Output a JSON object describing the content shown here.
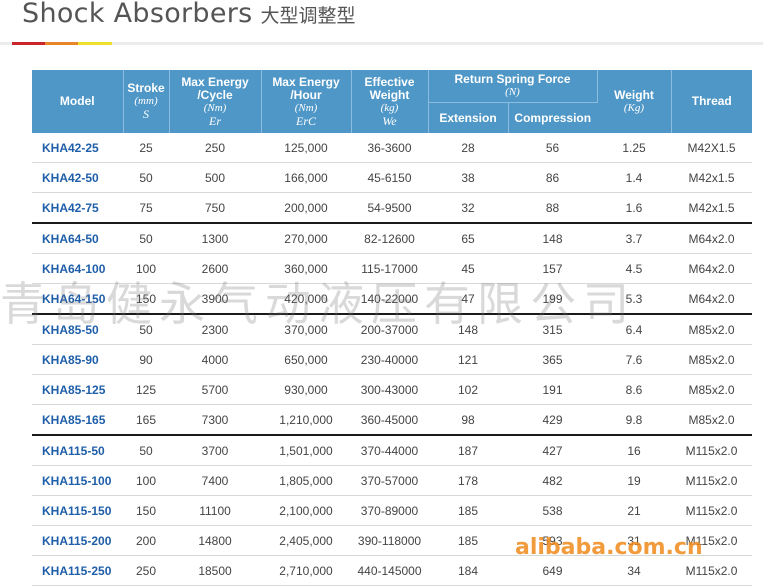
{
  "title": {
    "en": "Shock Absorbers",
    "cn": "大型调整型"
  },
  "headers": {
    "model": "Model",
    "stroke": "Stroke",
    "stroke_unit": "(mm)",
    "stroke_sym": "S",
    "max_energy_cycle": "Max Energy",
    "max_energy_cycle_2": "/Cycle",
    "max_energy_cycle_unit": "(Nm)",
    "max_energy_cycle_sym": "Er",
    "max_energy_hour": "Max Energy",
    "max_energy_hour_2": "/Hour",
    "max_energy_hour_unit": "(Nm)",
    "max_energy_hour_sym": "ErC",
    "effective_weight": "Effective",
    "effective_weight_2": "Weight",
    "effective_weight_unit": "(kg)",
    "effective_weight_sym": "We",
    "return_spring_force": "Return Spring Force",
    "return_spring_force_unit": "(N)",
    "extension": "Extension",
    "compression": "Compression",
    "weight": "Weight",
    "weight_unit": "(Kg)",
    "thread": "Thread"
  },
  "rows": [
    {
      "model": "KHA42-25",
      "stroke": "25",
      "energy_cycle": "250",
      "energy_hour": "125,000",
      "eff_weight": "36-3600",
      "extension": "28",
      "compression": "56",
      "weight": "1.25",
      "thread": "M42X1.5"
    },
    {
      "model": "KHA42-50",
      "stroke": "50",
      "energy_cycle": "500",
      "energy_hour": "166,000",
      "eff_weight": "45-6150",
      "extension": "38",
      "compression": "86",
      "weight": "1.4",
      "thread": "M42x1.5"
    },
    {
      "model": "KHA42-75",
      "stroke": "75",
      "energy_cycle": "750",
      "energy_hour": "200,000",
      "eff_weight": "54-9500",
      "extension": "32",
      "compression": "88",
      "weight": "1.6",
      "thread": "M42x1.5"
    },
    {
      "model": "KHA64-50",
      "stroke": "50",
      "energy_cycle": "1300",
      "energy_hour": "270,000",
      "eff_weight": "82-12600",
      "extension": "65",
      "compression": "148",
      "weight": "3.7",
      "thread": "M64x2.0"
    },
    {
      "model": "KHA64-100",
      "stroke": "100",
      "energy_cycle": "2600",
      "energy_hour": "360,000",
      "eff_weight": "115-17000",
      "extension": "45",
      "compression": "157",
      "weight": "4.5",
      "thread": "M64x2.0"
    },
    {
      "model": "KHA64-150",
      "stroke": "150",
      "energy_cycle": "3900",
      "energy_hour": "420,000",
      "eff_weight": "140-22000",
      "extension": "47",
      "compression": "199",
      "weight": "5.3",
      "thread": "M64x2.0"
    },
    {
      "model": "KHA85-50",
      "stroke": "50",
      "energy_cycle": "2300",
      "energy_hour": "370,000",
      "eff_weight": "200-37000",
      "extension": "148",
      "compression": "315",
      "weight": "6.4",
      "thread": "M85x2.0"
    },
    {
      "model": "KHA85-90",
      "stroke": "90",
      "energy_cycle": "4000",
      "energy_hour": "650,000",
      "eff_weight": "230-40000",
      "extension": "121",
      "compression": "365",
      "weight": "7.6",
      "thread": "M85x2.0"
    },
    {
      "model": "KHA85-125",
      "stroke": "125",
      "energy_cycle": "5700",
      "energy_hour": "930,000",
      "eff_weight": "300-43000",
      "extension": "102",
      "compression": "191",
      "weight": "8.6",
      "thread": "M85x2.0"
    },
    {
      "model": "KHA85-165",
      "stroke": "165",
      "energy_cycle": "7300",
      "energy_hour": "1,210,000",
      "eff_weight": "360-45000",
      "extension": "98",
      "compression": "429",
      "weight": "9.8",
      "thread": "M85x2.0"
    },
    {
      "model": "KHA115-50",
      "stroke": "50",
      "energy_cycle": "3700",
      "energy_hour": "1,501,000",
      "eff_weight": "370-44000",
      "extension": "187",
      "compression": "427",
      "weight": "16",
      "thread": "M115x2.0"
    },
    {
      "model": "KHA115-100",
      "stroke": "100",
      "energy_cycle": "7400",
      "energy_hour": "1,805,000",
      "eff_weight": "370-57000",
      "extension": "178",
      "compression": "482",
      "weight": "19",
      "thread": "M115x2.0"
    },
    {
      "model": "KHA115-150",
      "stroke": "150",
      "energy_cycle": "11100",
      "energy_hour": "2,100,000",
      "eff_weight": "370-89000",
      "extension": "185",
      "compression": "538",
      "weight": "21",
      "thread": "M115x2.0"
    },
    {
      "model": "KHA115-200",
      "stroke": "200",
      "energy_cycle": "14800",
      "energy_hour": "2,405,000",
      "eff_weight": "390-118000",
      "extension": "185",
      "compression": "593",
      "weight": "31",
      "thread": "M115x2.0"
    },
    {
      "model": "KHA115-250",
      "stroke": "250",
      "energy_cycle": "18500",
      "energy_hour": "2,710,000",
      "eff_weight": "440-145000",
      "extension": "184",
      "compression": "649",
      "weight": "34",
      "thread": "M115x2.0"
    }
  ],
  "group_starts": [
    3,
    6,
    10
  ],
  "watermark": "青岛健永气动液压有限公司",
  "logo": "alibaba.com.cn",
  "colors": {
    "header_bg": "#4f97c7",
    "model_text": "#1f5ea8",
    "stripe_red": "#c8252c",
    "stripe_orange": "#e9862a",
    "stripe_yellow": "#ede02a"
  }
}
